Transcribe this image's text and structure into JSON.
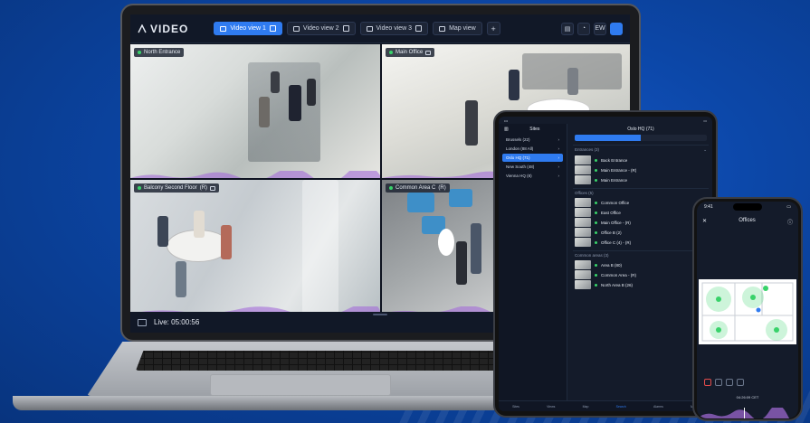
{
  "app": {
    "name": "VIDEO"
  },
  "laptop": {
    "tabs": [
      {
        "label": "Video view 1",
        "active": true
      },
      {
        "label": "Video view 2",
        "active": false
      },
      {
        "label": "Video view 3",
        "active": false
      },
      {
        "label": "Map view",
        "active": false
      }
    ],
    "add_tab": "+",
    "user_initials": "EW",
    "cameras": [
      {
        "label": "North Entrance"
      },
      {
        "label": "Main Office"
      },
      {
        "label": "Balcony Second Floor",
        "tag": "(R)"
      },
      {
        "label": "Common Area C",
        "tag": "(R)"
      }
    ],
    "live_label": "Live: 05:00:56"
  },
  "tablet": {
    "sites_title": "Sites",
    "sites": [
      {
        "name": "Brussels (22)",
        "active": false
      },
      {
        "name": "London (88 All)",
        "active": false
      },
      {
        "name": "Oslo HQ (71)",
        "active": true
      },
      {
        "name": "New South (48)",
        "active": false
      },
      {
        "name": "Vienna HQ (8)",
        "active": false
      }
    ],
    "panel_title": "Oslo HQ (71)",
    "sections": [
      {
        "title": "Entrances (3)",
        "cameras": [
          "Back Entrance",
          "Main Entrance - (R)",
          "Main Entrance"
        ]
      },
      {
        "title": "Offices (5)",
        "cameras": [
          "Common Office",
          "East Office",
          "Main Office - (R)",
          "Office B (2)",
          "Office C (4) - (R)"
        ]
      },
      {
        "title": "Common areas (3)",
        "cameras": [
          "Area B (80)",
          "Common Area - (R)",
          "North Area B (26)"
        ]
      }
    ],
    "nav": [
      "Sites",
      "Views",
      "Map",
      "Search",
      "Alarms",
      "Menu"
    ]
  },
  "phone": {
    "time": "9:41",
    "title": "Offices",
    "playback_time": "04:26:09 CET"
  },
  "colors": {
    "accent": "#2f7bf0",
    "status_ok": "#38d26a",
    "background": "#0c47a8"
  }
}
